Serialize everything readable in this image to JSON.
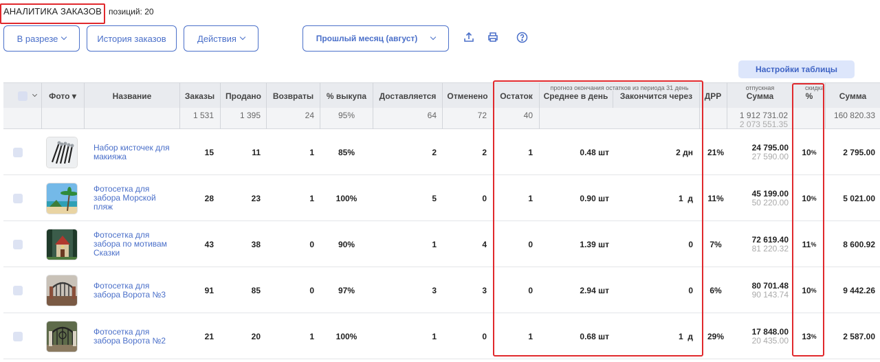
{
  "header": {
    "title": "АНАЛИТИКА ЗАКАЗОВ",
    "count": "позиций: 20"
  },
  "toolbar": {
    "breakdown_label": "В разрезе",
    "history_label": "История заказов",
    "actions_label": "Действия",
    "period_label": "Прошлый месяц (август)",
    "icons": [
      "upload-icon",
      "print-icon",
      "help-icon"
    ]
  },
  "settings_label": "Настройки таблицы",
  "columns": {
    "photo": "Фото ▾",
    "name": "Название",
    "orders": "Заказы",
    "sold": "Продано",
    "returns": "Возвраты",
    "buyout": "% выкупа",
    "delivering": "Доставляется",
    "cancelled": "Отменено",
    "stock": "Остаток",
    "forecast_group": "прогноз окончания остатков из периода 31 день",
    "avg_per_day": "Среднее в день",
    "ends_in": "Закончится через",
    "drr": "ДРР",
    "sale_group": "отпускная",
    "sale_sum": "Сумма",
    "discount_group": "скидка",
    "discount_pct": "%",
    "discount_sum": "Сумма"
  },
  "totals": {
    "orders": "1 531",
    "sold": "1 395",
    "returns": "24",
    "buyout": "95%",
    "delivering": "64",
    "cancelled": "72",
    "stock": "40",
    "sale_sum": "1 912 731.02",
    "sale_sum_full": "2 073 551.35",
    "discount_sum": "160 820.33"
  },
  "rows": [
    {
      "name": "Набор кисточек для макияжа",
      "orders": "15",
      "sold": "11",
      "returns": "1",
      "buyout": "85%",
      "delivering": "2",
      "cancelled": "2",
      "stock": "1",
      "avg": "0.48 шт",
      "ends": "2 дн",
      "drr": "21%",
      "sum": "24 795.00",
      "sum_full": "27 590.00",
      "pct": "10",
      "pct_sign": "%",
      "disc_sum": "2 795.00"
    },
    {
      "name": "Фотосетка для забора Морской пляж",
      "orders": "28",
      "sold": "23",
      "returns": "1",
      "buyout": "100%",
      "delivering": "5",
      "cancelled": "0",
      "stock": "1",
      "avg": "0.90 шт",
      "ends": "1  д",
      "drr": "11%",
      "sum": "45 199.00",
      "sum_full": "50 220.00",
      "pct": "10",
      "pct_sign": "%",
      "disc_sum": "5 021.00"
    },
    {
      "name": "Фотосетка для забора по мотивам Сказки",
      "orders": "43",
      "sold": "38",
      "returns": "0",
      "buyout": "90%",
      "delivering": "1",
      "cancelled": "4",
      "stock": "0",
      "avg": "1.39 шт",
      "ends": "0",
      "drr": "7%",
      "sum": "72 619.40",
      "sum_full": "81 220.32",
      "pct": "11",
      "pct_sign": "%",
      "disc_sum": "8 600.92"
    },
    {
      "name": "Фотосетка для забора Ворота №3",
      "orders": "91",
      "sold": "85",
      "returns": "0",
      "buyout": "97%",
      "delivering": "3",
      "cancelled": "3",
      "stock": "0",
      "avg": "2.94 шт",
      "ends": "0",
      "drr": "6%",
      "sum": "80 701.48",
      "sum_full": "90 143.74",
      "pct": "10",
      "pct_sign": "%",
      "disc_sum": "9 442.26"
    },
    {
      "name": "Фотосетка для забора Ворота №2",
      "orders": "21",
      "sold": "20",
      "returns": "1",
      "buyout": "100%",
      "delivering": "1",
      "cancelled": "0",
      "stock": "1",
      "avg": "0.68 шт",
      "ends": "1  д",
      "drr": "29%",
      "sum": "17 848.00",
      "sum_full": "20 435.00",
      "pct": "13",
      "pct_sign": "%",
      "disc_sum": "2 587.00"
    }
  ],
  "colors": {
    "accent": "#4a6fc9",
    "highlight": "#e0282c",
    "header_bg": "#e9ebef"
  }
}
